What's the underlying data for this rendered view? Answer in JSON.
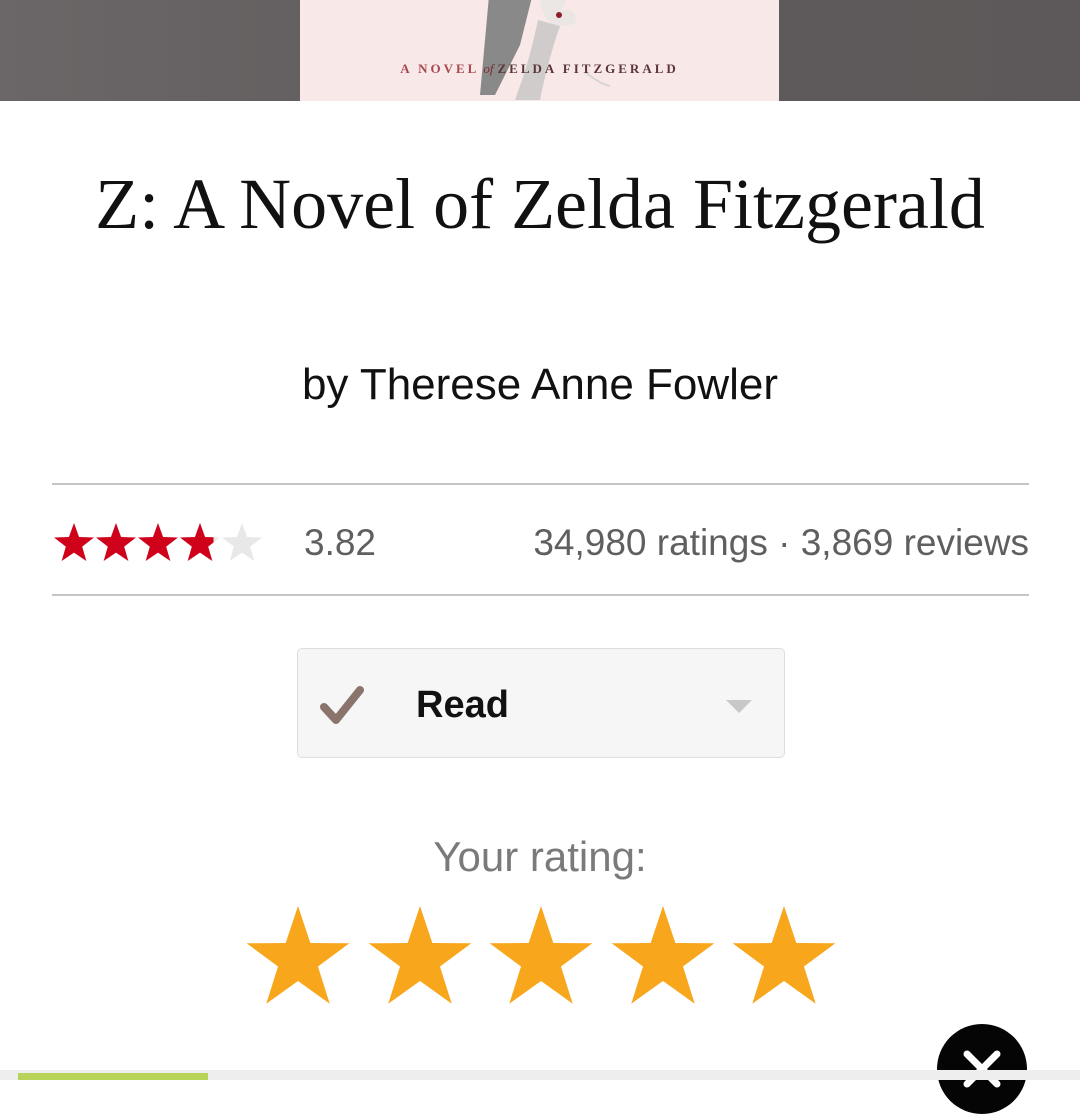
{
  "cover": {
    "text_prefix": "A NOVEL",
    "text_of": "of",
    "text_name": "ZELDA FITZGERALD"
  },
  "book": {
    "title": "Z: A Novel of Zelda Fitzgerald",
    "author": "by Therese Anne Fowler"
  },
  "stats": {
    "average_rating": "3.82",
    "average_rating_value": 3.82,
    "counts": "34,980 ratings · 3,869 reviews",
    "star_color": "#d0021b",
    "empty_star_color": "#e8e8e8"
  },
  "shelf": {
    "label": "Read",
    "check_color": "#8a746b"
  },
  "user_rating": {
    "label": "Your rating:",
    "stars": 5,
    "star_color": "#f8a61c"
  },
  "icons": [
    "check-icon",
    "caret-down-icon",
    "star-icon",
    "close-icon"
  ]
}
